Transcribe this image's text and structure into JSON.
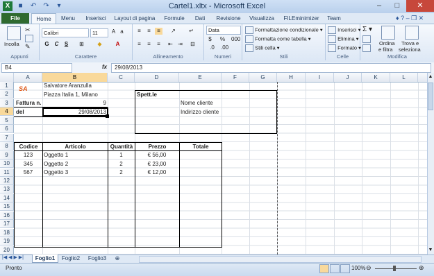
{
  "window": {
    "title": "Cartel1.xltx - Microsoft Excel"
  },
  "tabs": [
    "File",
    "Home",
    "Menu",
    "Inserisci",
    "Layout di pagina",
    "Formule",
    "Dati",
    "Revisione",
    "Visualizza",
    "FILEminimizer",
    "Team"
  ],
  "ribbon": {
    "appunti": {
      "label": "Appunti",
      "incolla": "Incolla"
    },
    "carattere": {
      "label": "Carattere",
      "font": "Calibri",
      "size": "11"
    },
    "allineamento": {
      "label": "Allineamento"
    },
    "numeri": {
      "label": "Numeri",
      "format": "Data"
    },
    "stili": {
      "label": "Stili",
      "conditional": "Formattazione condizionale",
      "table": "Formatta come tabella",
      "cell": "Stili cella"
    },
    "celle": {
      "label": "Celle",
      "insert": "Inserisci",
      "delete": "Elimina",
      "format": "Formato"
    },
    "modifica": {
      "label": "Modifica",
      "sort": "Ordina",
      "sort2": "e filtra",
      "find": "Trova e",
      "find2": "seleziona"
    }
  },
  "formula_bar": {
    "name_box": "B4",
    "fx": "fx",
    "value": "29/08/2013"
  },
  "columns": [
    "A",
    "B",
    "C",
    "D",
    "E",
    "F",
    "G",
    "H",
    "I",
    "J",
    "K",
    "L"
  ],
  "rows": [
    "1",
    "2",
    "3",
    "4",
    "5",
    "6",
    "7",
    "8",
    "9",
    "10",
    "11",
    "12",
    "13",
    "14",
    "15",
    "16",
    "17",
    "18",
    "19",
    "20"
  ],
  "sheet": {
    "logo": "SA",
    "b1": "Salvatore Aranzulla",
    "b2": "Piazza Italia 1, Milano",
    "a3": "Fattura n.",
    "b3": "9",
    "a4": "del",
    "b4": "29/08/2013",
    "d2": "Spett.le",
    "e3": "Nome cliente",
    "e4": "Indirizzo cliente",
    "headers": [
      "Codice",
      "Articolo",
      "Quantità",
      "Prezzo",
      "Totale"
    ],
    "items": [
      {
        "codice": "123",
        "articolo": "Oggetto 1",
        "quantita": "1",
        "prezzo": "€ 56,00"
      },
      {
        "codice": "345",
        "articolo": "Oggetto 2",
        "quantita": "2",
        "prezzo": "€ 23,00"
      },
      {
        "codice": "567",
        "articolo": "Oggetto 3",
        "quantita": "2",
        "prezzo": "€ 12,00"
      }
    ]
  },
  "sheets": [
    "Foglio1",
    "Foglio2",
    "Foglio3"
  ],
  "status": {
    "text": "Pronto",
    "zoom": "100%"
  }
}
